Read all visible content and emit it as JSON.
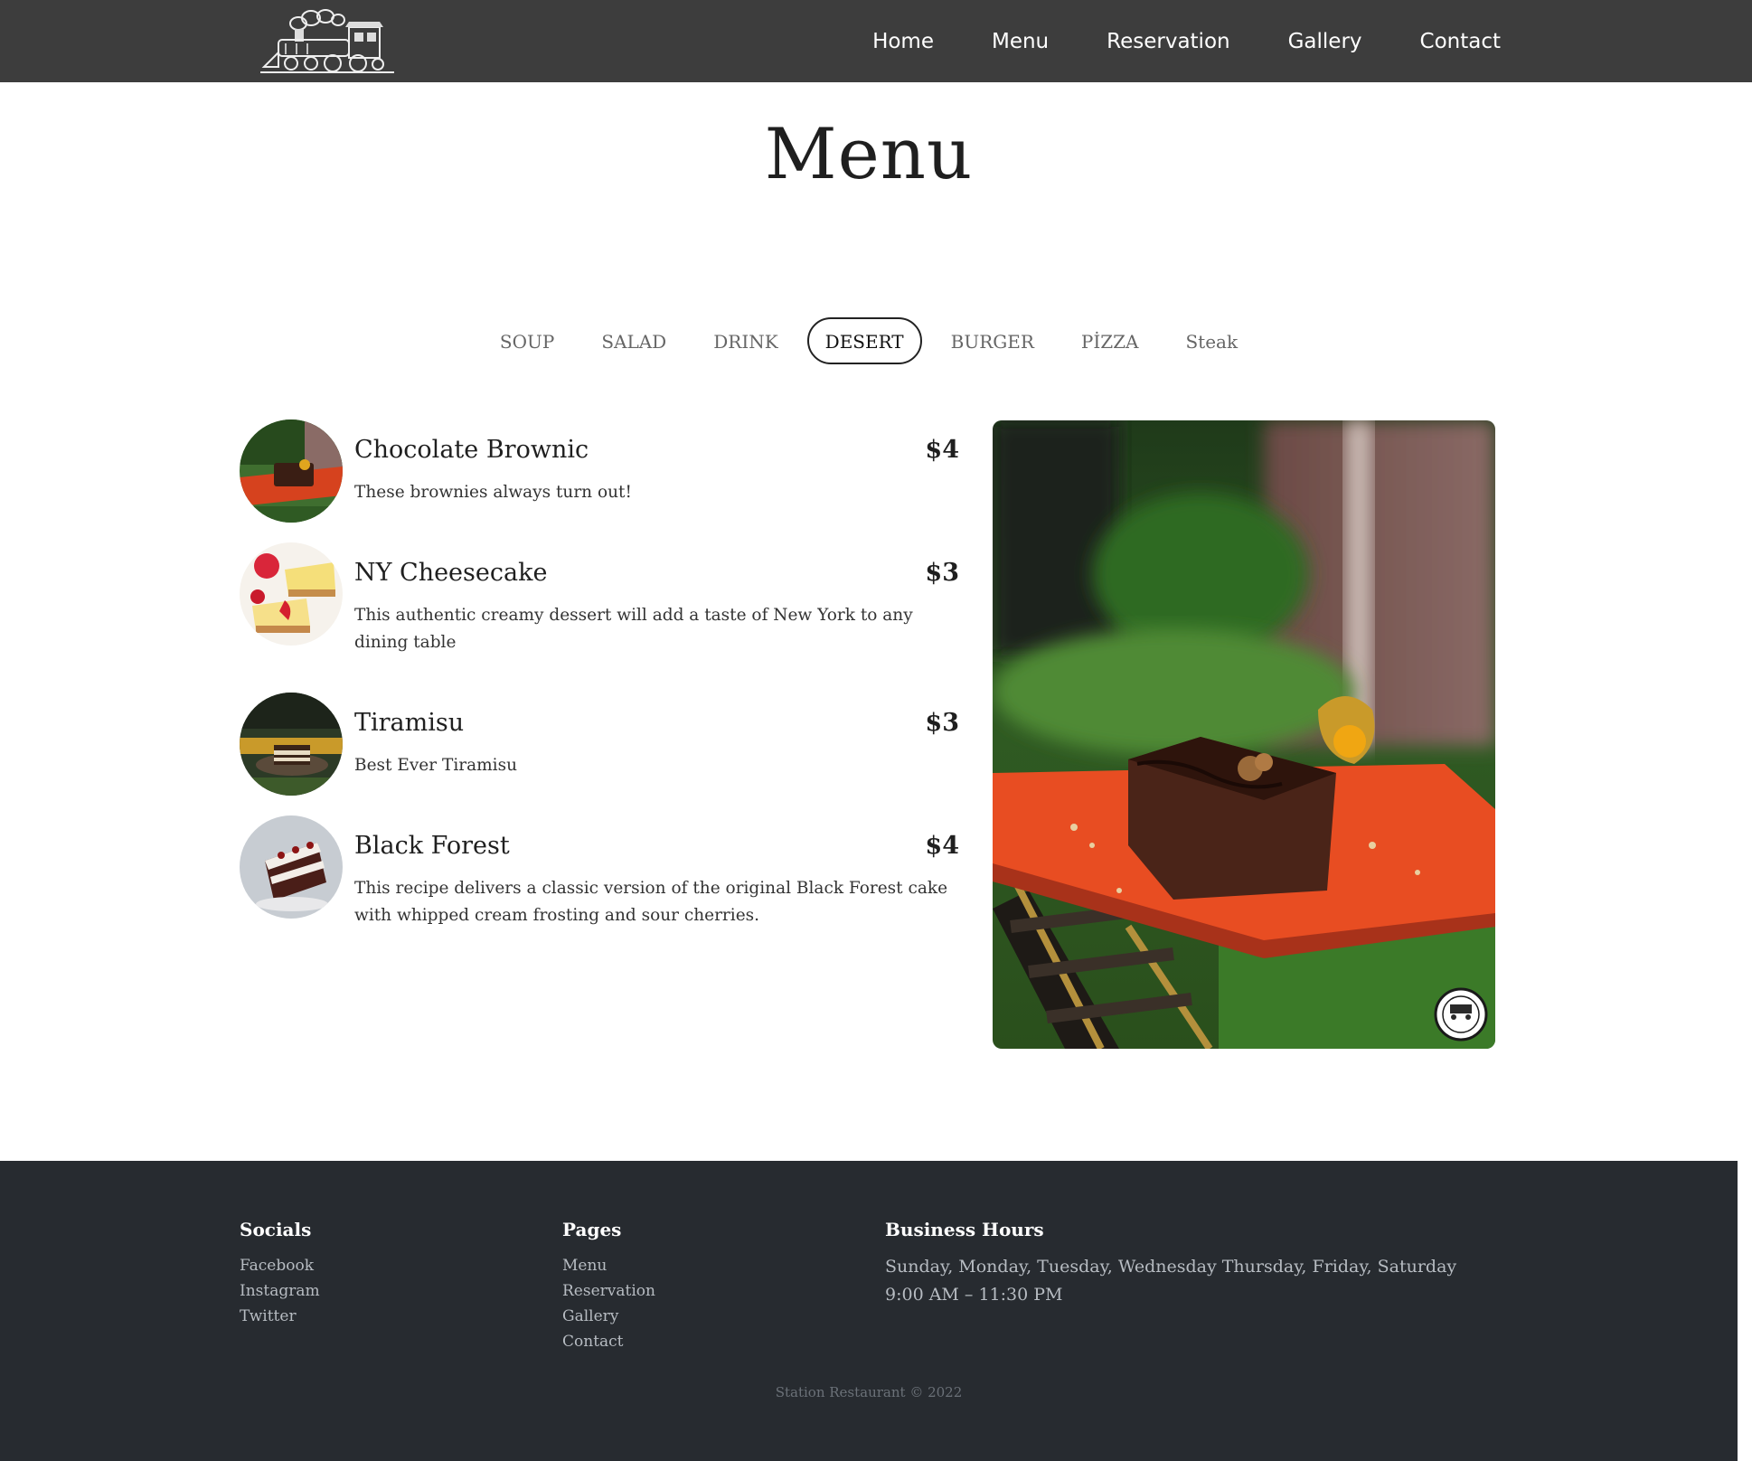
{
  "nav": {
    "links": [
      "Home",
      "Menu",
      "Reservation",
      "Gallery",
      "Contact"
    ]
  },
  "page": {
    "title": "Menu"
  },
  "tabs": {
    "items": [
      "SOUP",
      "SALAD",
      "DRINK",
      "DESERT",
      "BURGER",
      "PİZZA",
      "Steak"
    ],
    "active": "DESERT"
  },
  "menu_items": [
    {
      "name": "Chocolate Brownic",
      "price": "$4",
      "description": "These brownies always turn out!"
    },
    {
      "name": "NY Cheesecake",
      "price": "$3",
      "description": "This authentic creamy dessert will add a taste of New York to any dining table"
    },
    {
      "name": "Tiramisu",
      "price": "$3",
      "description": "Best Ever Tiramisu"
    },
    {
      "name": "Black Forest",
      "price": "$4",
      "description": "This recipe delivers a classic version of the original Black Forest cake with whipped cream frosting and sour cherries."
    }
  ],
  "footer": {
    "socials": {
      "heading": "Socials",
      "links": [
        "Facebook",
        "Instagram",
        "Twitter"
      ]
    },
    "pages": {
      "heading": "Pages",
      "links": [
        "Menu",
        "Reservation",
        "Gallery",
        "Contact"
      ]
    },
    "hours": {
      "heading": "Business Hours",
      "days": "Sunday, Monday, Tuesday, Wednesday Thursday, Friday, Saturday",
      "time": "9:00 AM – 11:30 PM"
    },
    "copyright": "Station Restaurant © 2022"
  },
  "colors": {
    "navbar": "#3d3d3d",
    "footer": "#272b30",
    "text_dark": "#1f1f1f"
  }
}
